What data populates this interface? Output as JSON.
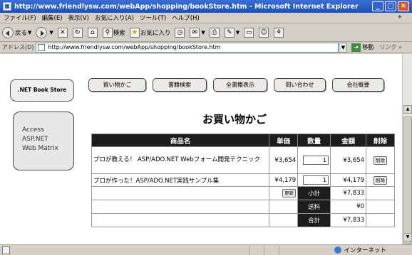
{
  "window": {
    "title": "http://www.friendlysw.com/webApp/shopping/bookStore.htm - Microsoft Internet Explorer",
    "min": "_",
    "max": "□",
    "close": "×"
  },
  "menu": [
    "ファイル(F)",
    "編集(E)",
    "表示(V)",
    "お気に入り(A)",
    "ツール(T)",
    "ヘルプ(H)"
  ],
  "toolbar": {
    "back_label": "戻る",
    "search_label": "検索",
    "favorites_label": "お気に入り"
  },
  "address": {
    "label": "アドレス(D)",
    "url": "http://www.friendlysw.com/webApp/shopping/bookStore.htm",
    "go_label": "移動",
    "links_label": "リンク »"
  },
  "page": {
    "logo": ".NET Book Store",
    "tabs": [
      "買い物かご",
      "書籍検索",
      "全書籍表示",
      "問い合わせ",
      "会社概要"
    ],
    "side_links": [
      "Access",
      "ASP.NET",
      "Web Matrix"
    ],
    "heading": "お買い物かご"
  },
  "cart": {
    "headers": [
      "商品名",
      "単価",
      "数量",
      "金額",
      "削除"
    ],
    "rows": [
      {
        "name": "プロが教える！ ASP/ADO.NET Webフォーム開発テクニック",
        "price": "¥3,654",
        "qty": "1",
        "amount": "¥3,654",
        "delete_label": "削除"
      },
      {
        "name": "プロが作った！ASP/ADO.NET実践サンプル集",
        "price": "¥4,179",
        "qty": "1",
        "amount": "¥4,179",
        "delete_label": "削除"
      }
    ],
    "update_label": "更新",
    "subtotal_label": "小計",
    "subtotal": "¥7,833",
    "shipping_label": "送料",
    "shipping": "¥0",
    "total_label": "合計",
    "total": "¥7,833"
  },
  "status": {
    "zone": "インターネット"
  }
}
